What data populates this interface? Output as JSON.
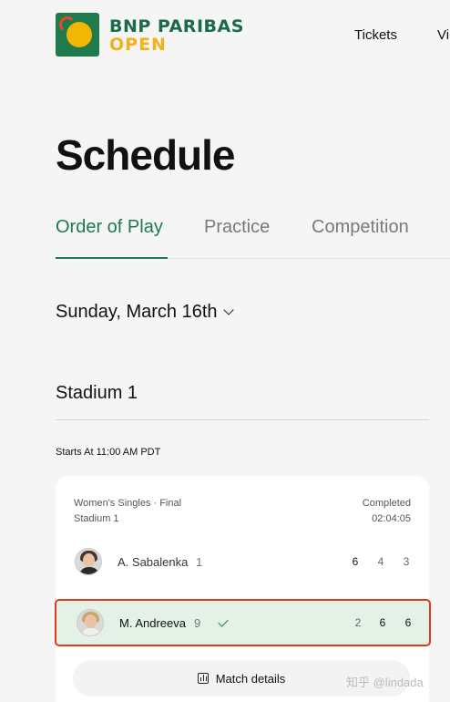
{
  "header": {
    "brand_line1": "BNP PARIBAS",
    "brand_line2": "OPEN",
    "nav": [
      "Tickets",
      "Vi"
    ]
  },
  "page_title": "Schedule",
  "tabs": [
    {
      "label": "Order of Play",
      "active": true
    },
    {
      "label": "Practice",
      "active": false
    },
    {
      "label": "Competition",
      "active": false
    }
  ],
  "date": "Sunday, March 16th",
  "court": "Stadium 1",
  "starts_at": "Starts At 11:00 AM PDT",
  "match": {
    "event": "Women's Singles · Final",
    "court": "Stadium 1",
    "status": "Completed",
    "duration": "02:04:05",
    "players": [
      {
        "name": "A. Sabalenka",
        "seed": "1",
        "scores": [
          "6",
          "4",
          "3"
        ],
        "winner": false
      },
      {
        "name": "M. Andreeva",
        "seed": "9",
        "scores": [
          "2",
          "6",
          "6"
        ],
        "winner": true
      }
    ],
    "details_label": "Match details"
  },
  "watermark": "知乎 @lindada",
  "colors": {
    "accent_green": "#1c7a4e",
    "highlight_border": "#e03a24",
    "winner_bg": "#e3f1e7"
  }
}
